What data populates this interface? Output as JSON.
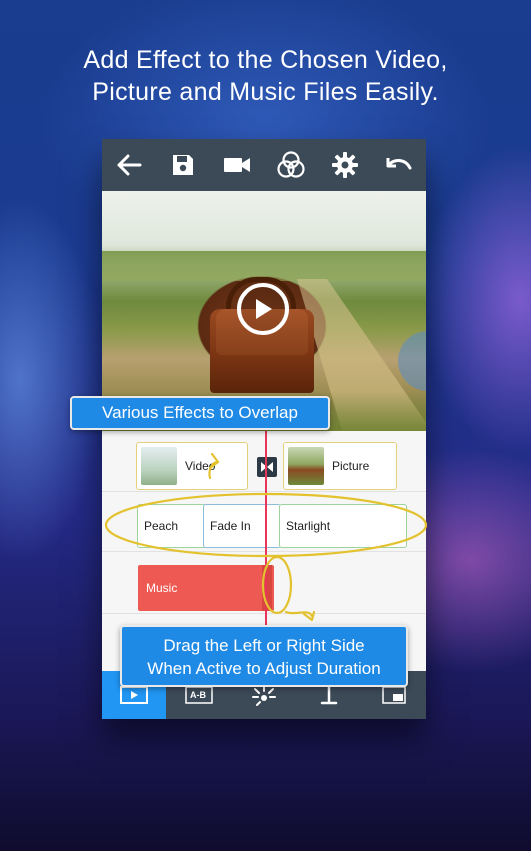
{
  "promo": {
    "line1": "Add Effect to the Chosen Video,",
    "line2": "Picture and Music Files Easily."
  },
  "toolbar": {
    "icons": [
      "back-arrow-icon",
      "save-icon",
      "video-camera-icon",
      "color-filter-icon",
      "settings-gear-icon",
      "undo-icon"
    ]
  },
  "timeline": {
    "clips": [
      {
        "label": "Video"
      },
      {
        "label": "Picture"
      }
    ],
    "effects": [
      {
        "label": "Peach"
      },
      {
        "label": "Fade In"
      },
      {
        "label": "Starlight"
      }
    ],
    "music": {
      "label": "Music"
    }
  },
  "callouts": {
    "effects": "Various Effects to Overlap",
    "drag_line1": "Drag the Left or Right Side",
    "drag_line2": "When Active to Adjust Duration"
  },
  "bottom_bar": {
    "icons": [
      "play-media-icon",
      "text-ab-icon",
      "effects-sparkle-icon",
      "text-cursor-icon",
      "picture-in-picture-icon"
    ],
    "active_index": 0
  },
  "colors": {
    "toolbar": "#3c4a57",
    "accent_blue": "#1e8ae6",
    "music_red": "#ee5a53",
    "playhead": "#e8365a",
    "annotation_yellow": "#e3c22e"
  }
}
